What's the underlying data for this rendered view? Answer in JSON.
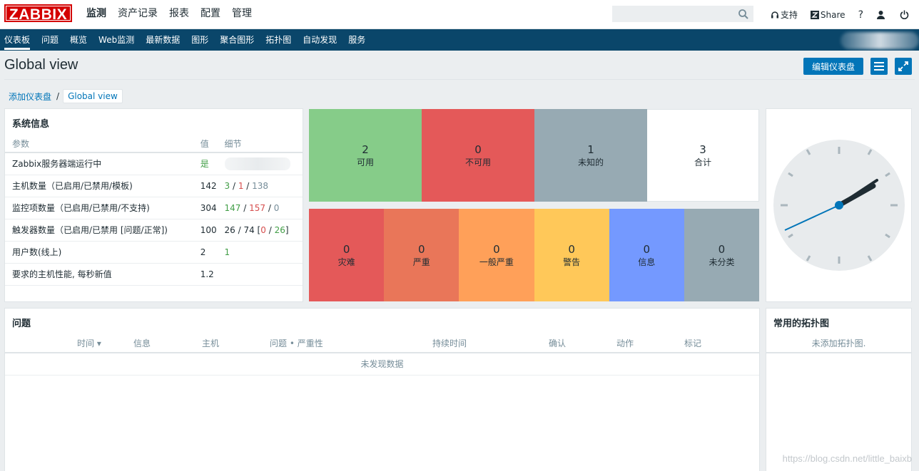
{
  "app": {
    "logo": "ZABBIX"
  },
  "main_menu": [
    "监测",
    "资产记录",
    "报表",
    "配置",
    "管理"
  ],
  "search": {
    "placeholder": ""
  },
  "top_icons": {
    "support_label": "支持",
    "share_label": "Share",
    "help_label": "?"
  },
  "sub_menu": [
    "仪表板",
    "问题",
    "概览",
    "Web监测",
    "最新数据",
    "图形",
    "聚合图形",
    "拓扑图",
    "自动发现",
    "服务"
  ],
  "header": {
    "title": "Global view",
    "edit_button": "编辑仪表盘"
  },
  "breadcrumb": {
    "parent": "添加仪表盘",
    "separator": "/",
    "current": "Global view"
  },
  "system_info": {
    "title": "系统信息",
    "columns": [
      "参数",
      "值",
      "细节"
    ],
    "rows": [
      {
        "param": "Zabbix服务器端运行中",
        "value": "是"
      },
      {
        "param": "主机数量（已启用/已禁用/模板)",
        "value": "142",
        "d1": "3",
        "d2": "1",
        "d3": "138"
      },
      {
        "param": "监控项数量（已启用/已禁用/不支持)",
        "value": "304",
        "d1": "147",
        "d2": "157",
        "d3": "0"
      },
      {
        "param": "触发器数量（已启用/已禁用 [问题/正常])",
        "value": "100",
        "d0": "26 / 74 [",
        "d1": "0",
        "d2": "26",
        "d3": "]"
      },
      {
        "param": "用户数(线上)",
        "value": "2",
        "d1": "1"
      },
      {
        "param": "要求的主机性能, 每秒新值",
        "value": "1.2"
      }
    ]
  },
  "host_availability": {
    "cells": [
      {
        "num": "2",
        "label": "可用",
        "color": "#86cc89"
      },
      {
        "num": "0",
        "label": "不可用",
        "color": "#e45959"
      },
      {
        "num": "1",
        "label": "未知的",
        "color": "#97aab3"
      },
      {
        "num": "3",
        "label": "合计",
        "color": "#ffffff"
      }
    ]
  },
  "problems_by_severity": {
    "cells": [
      {
        "num": "0",
        "label": "灾难",
        "color": "#e45959"
      },
      {
        "num": "0",
        "label": "严重",
        "color": "#e97659"
      },
      {
        "num": "0",
        "label": "一般严重",
        "color": "#ffa059"
      },
      {
        "num": "0",
        "label": "警告",
        "color": "#ffc859"
      },
      {
        "num": "0",
        "label": "信息",
        "color": "#7499ff"
      },
      {
        "num": "0",
        "label": "未分类",
        "color": "#97aab3"
      }
    ]
  },
  "problems": {
    "title": "问题",
    "columns": [
      "时间 ▾",
      "信息",
      "主机",
      "问题 • 严重性",
      "持续时间",
      "确认",
      "动作",
      "标记"
    ],
    "empty": "未发现数据"
  },
  "favourite_maps": {
    "title": "常用的拓扑图",
    "empty": "未添加拓扑图."
  },
  "watermark": "https://blog.csdn.net/little_baixb",
  "colors": {
    "nav": "#0a466a",
    "accent": "#0275b8",
    "clock_hand": "#0275b8"
  }
}
